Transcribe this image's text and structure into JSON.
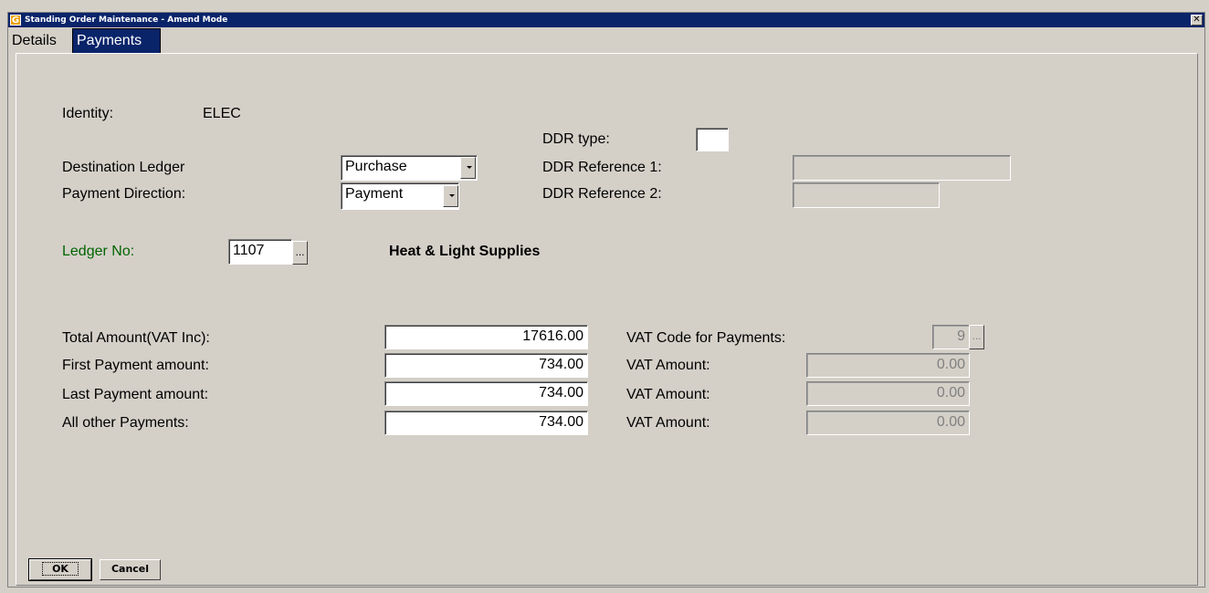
{
  "window": {
    "title": "Standing Order Maintenance - Amend Mode",
    "icon_letter": "G",
    "close_glyph": "✕"
  },
  "tabs": [
    {
      "label": "Details",
      "active": false
    },
    {
      "label": "Payments",
      "active": true
    }
  ],
  "identity": {
    "label": "Identity:",
    "value": "ELEC"
  },
  "destination_ledger": {
    "label": "Destination Ledger",
    "value": "Purchase"
  },
  "payment_direction": {
    "label": "Payment Direction:",
    "value": "Payment"
  },
  "ddr": {
    "type_label": "DDR type:",
    "type_value": "",
    "ref1_label": "DDR Reference 1:",
    "ref1_value": "",
    "ref2_label": "DDR Reference 2:",
    "ref2_value": ""
  },
  "ledger_no": {
    "label": "Ledger No:",
    "value": "1107",
    "name": "Heat & Light Supplies",
    "lookup": "..."
  },
  "amounts": {
    "total_label": "Total Amount(VAT Inc):",
    "total_value": "17616.00",
    "first_label": "First Payment amount:",
    "first_value": "734.00",
    "last_label": "Last Payment amount:",
    "last_value": "734.00",
    "other_label": "All other Payments:",
    "other_value": "734.00"
  },
  "vat": {
    "code_label": "VAT Code for Payments:",
    "code_value": "9",
    "code_lookup": "...",
    "amount_label": "VAT Amount:",
    "first_amount": "0.00",
    "last_amount": "0.00",
    "other_amount": "0.00"
  },
  "buttons": {
    "ok": "OK",
    "cancel": "Cancel"
  },
  "colors": {
    "titlebar": "#0a246a",
    "ledger_label": "#006400",
    "background": "#d4d0c8"
  }
}
